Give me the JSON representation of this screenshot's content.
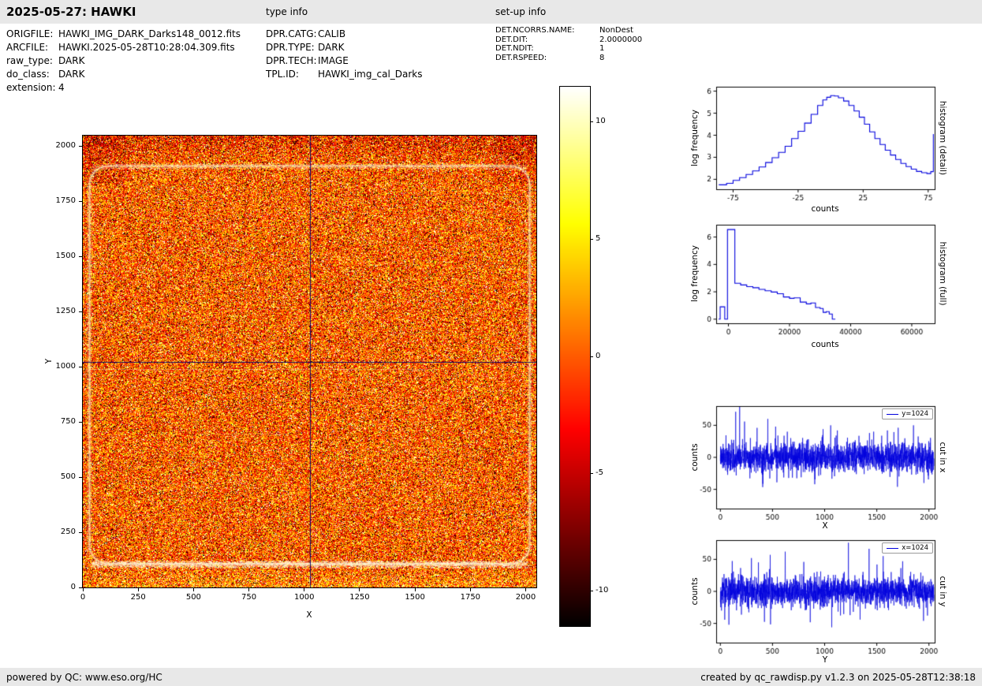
{
  "header": {
    "title": "2025-05-27: HAWKI",
    "type_info_label": "type info",
    "setup_info_label": "set-up info"
  },
  "metadata": {
    "left": [
      {
        "label": "ORIGFILE:",
        "value": "HAWKI_IMG_DARK_Darks148_0012.fits"
      },
      {
        "label": "ARCFILE:",
        "value": "HAWKI.2025-05-28T10:28:04.309.fits"
      },
      {
        "label": "raw_type:",
        "value": "DARK"
      },
      {
        "label": "do_class:",
        "value": "DARK"
      },
      {
        "label": "extension:",
        "value": "4"
      }
    ],
    "middle": [
      {
        "label": "DPR.CATG:",
        "value": "CALIB"
      },
      {
        "label": "DPR.TYPE:",
        "value": "DARK"
      },
      {
        "label": "DPR.TECH:",
        "value": "IMAGE"
      },
      {
        "label": "TPL.ID:",
        "value": "HAWKI_img_cal_Darks"
      }
    ],
    "right": [
      {
        "label": "DET.NCORRS.NAME:",
        "value": "NonDest"
      },
      {
        "label": "DET.DIT:",
        "value": "2.0000000"
      },
      {
        "label": "DET.NDIT:",
        "value": "1"
      },
      {
        "label": "DET.RSPEED:",
        "value": "8"
      }
    ]
  },
  "footer": {
    "left": "powered by QC: www.eso.org/HC",
    "right": "created by qc_rawdisp.py v1.2.3 on 2025-05-28T12:38:18"
  },
  "chart_data": [
    {
      "id": "raw_dark_frame_image",
      "type": "heatmap",
      "xlabel": "X",
      "ylabel": "Y",
      "xlim": [
        0,
        2048
      ],
      "ylim": [
        0,
        2048
      ],
      "xticks": [
        0,
        250,
        500,
        750,
        1000,
        1250,
        1500,
        1750,
        2000
      ],
      "yticks": [
        0,
        250,
        500,
        750,
        1000,
        1250,
        1500,
        1750,
        2000
      ],
      "colormap": "hot",
      "value_range": [
        -11.5,
        11.5
      ],
      "noise_sigma": 4.2,
      "crosshair": {
        "x": 1024,
        "y": 1024
      },
      "colorbar_ticks": [
        10,
        5,
        0,
        -5,
        -10
      ]
    },
    {
      "id": "histogram_detail",
      "type": "line",
      "style": "step",
      "xlabel": "counts",
      "ylabel": "log frequency",
      "right_label": "histogram (detail)",
      "xlim": [
        -88,
        80
      ],
      "ylim": [
        1.55,
        6.2
      ],
      "xticks": [
        -75,
        -25,
        25,
        75
      ],
      "yticks": [
        2,
        3,
        4,
        5,
        6
      ],
      "points": [
        [
          -86,
          1.75
        ],
        [
          -80,
          1.82
        ],
        [
          -75,
          1.95
        ],
        [
          -70,
          2.08
        ],
        [
          -65,
          2.22
        ],
        [
          -60,
          2.38
        ],
        [
          -55,
          2.56
        ],
        [
          -50,
          2.76
        ],
        [
          -45,
          2.98
        ],
        [
          -40,
          3.22
        ],
        [
          -35,
          3.5
        ],
        [
          -30,
          3.85
        ],
        [
          -25,
          4.18
        ],
        [
          -20,
          4.55
        ],
        [
          -15,
          4.95
        ],
        [
          -10,
          5.35
        ],
        [
          -6,
          5.6
        ],
        [
          -3,
          5.72
        ],
        [
          0,
          5.8
        ],
        [
          3,
          5.78
        ],
        [
          6,
          5.7
        ],
        [
          10,
          5.55
        ],
        [
          14,
          5.35
        ],
        [
          18,
          5.1
        ],
        [
          22,
          4.82
        ],
        [
          26,
          4.5
        ],
        [
          30,
          4.15
        ],
        [
          34,
          3.85
        ],
        [
          38,
          3.58
        ],
        [
          42,
          3.32
        ],
        [
          46,
          3.1
        ],
        [
          50,
          2.9
        ],
        [
          54,
          2.72
        ],
        [
          58,
          2.58
        ],
        [
          62,
          2.46
        ],
        [
          66,
          2.36
        ],
        [
          70,
          2.3
        ],
        [
          74,
          2.26
        ],
        [
          77,
          2.35
        ],
        [
          79,
          4.05
        ]
      ]
    },
    {
      "id": "histogram_full",
      "type": "line",
      "style": "step",
      "xlabel": "counts",
      "ylabel": "log frequency",
      "right_label": "histogram (full)",
      "xlim": [
        -4000,
        67500
      ],
      "ylim": [
        -0.3,
        6.9
      ],
      "xticks": [
        0,
        20000,
        40000,
        60000
      ],
      "yticks": [
        0,
        2,
        4,
        6
      ],
      "points": [
        [
          -3200,
          0
        ],
        [
          -2700,
          0.9
        ],
        [
          -1600,
          0.9
        ],
        [
          -1200,
          0
        ],
        [
          -600,
          0
        ],
        [
          -300,
          6.55
        ],
        [
          1600,
          6.55
        ],
        [
          2100,
          2.62
        ],
        [
          4000,
          2.5
        ],
        [
          6000,
          2.38
        ],
        [
          8000,
          2.3
        ],
        [
          10000,
          2.18
        ],
        [
          12000,
          2.08
        ],
        [
          14000,
          1.98
        ],
        [
          16000,
          1.86
        ],
        [
          18000,
          1.62
        ],
        [
          20000,
          1.52
        ],
        [
          21500,
          1.56
        ],
        [
          23500,
          1.25
        ],
        [
          25500,
          1.12
        ],
        [
          27000,
          1.18
        ],
        [
          28500,
          0.85
        ],
        [
          30000,
          0.78
        ],
        [
          31000,
          0.5
        ],
        [
          32000,
          0.55
        ],
        [
          33000,
          0.38
        ],
        [
          34000,
          0
        ],
        [
          35000,
          0
        ]
      ]
    },
    {
      "id": "cut_in_x",
      "type": "line",
      "xlabel": "X",
      "ylabel": "counts",
      "right_label": "cut in x",
      "legend": "y=1024",
      "xlim": [
        -40,
        2055
      ],
      "ylim": [
        -80,
        80
      ],
      "xticks": [
        0,
        500,
        1000,
        1500,
        2000
      ],
      "yticks": [
        -50,
        0,
        50
      ],
      "n_points": 2048,
      "noise_sigma": 11,
      "spikes": [
        [
          185,
          86
        ],
        [
          352,
          46
        ],
        [
          455,
          60
        ],
        [
          530,
          48
        ],
        [
          642,
          40
        ],
        [
          905,
          -42
        ],
        [
          985,
          44
        ],
        [
          1058,
          50
        ],
        [
          1122,
          42
        ],
        [
          1430,
          38
        ],
        [
          1602,
          42
        ],
        [
          1698,
          -46
        ],
        [
          1852,
          50
        ],
        [
          1952,
          -40
        ]
      ]
    },
    {
      "id": "cut_in_y",
      "type": "line",
      "xlabel": "Y",
      "ylabel": "counts",
      "right_label": "cut in y",
      "legend": "x=1024",
      "xlim": [
        -40,
        2055
      ],
      "ylim": [
        -80,
        80
      ],
      "xticks": [
        0,
        500,
        1000,
        1500,
        2000
      ],
      "yticks": [
        -50,
        0,
        50
      ],
      "n_points": 2048,
      "noise_sigma": 11,
      "spikes": [
        [
          82,
          -52
        ],
        [
          298,
          52
        ],
        [
          478,
          57
        ],
        [
          622,
          62
        ],
        [
          800,
          46
        ],
        [
          1068,
          -56
        ],
        [
          1228,
          76
        ],
        [
          1340,
          -44
        ],
        [
          1502,
          42
        ],
        [
          1748,
          47
        ],
        [
          1948,
          -46
        ]
      ]
    }
  ]
}
